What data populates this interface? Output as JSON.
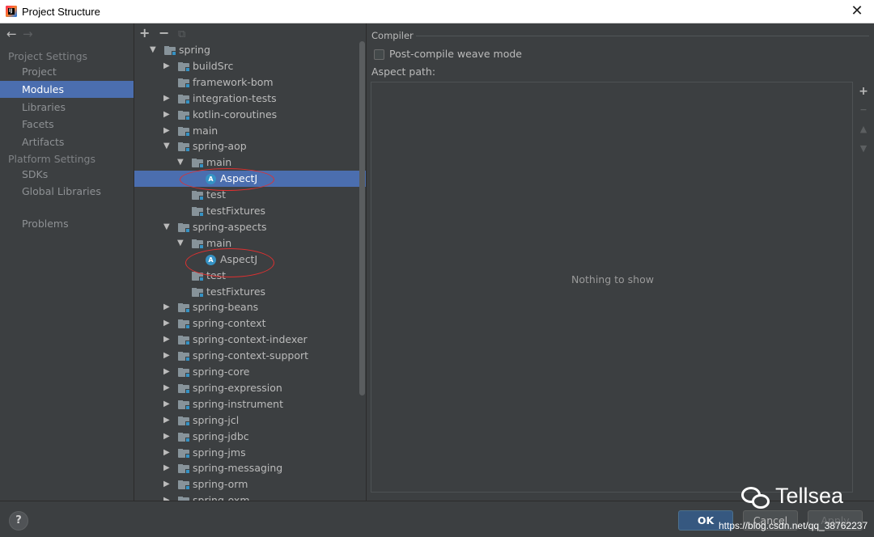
{
  "window": {
    "title": "Project Structure",
    "app_icon": "IJ",
    "close_glyph": "✕"
  },
  "sidebar": {
    "back_glyph": "←",
    "forward_glyph": "→",
    "project_settings_header": "Project Settings",
    "project_settings_items": [
      "Project",
      "Modules",
      "Libraries",
      "Facets",
      "Artifacts"
    ],
    "selected_item": "Modules",
    "platform_settings_header": "Platform Settings",
    "platform_settings_items": [
      "SDKs",
      "Global Libraries"
    ],
    "problems": "Problems"
  },
  "tree": {
    "toolbar": {
      "add": "+",
      "remove": "−",
      "copy": "⧉"
    },
    "rows": [
      {
        "label": "spring",
        "depth": 0,
        "expanded": true,
        "icon": "module-folder-icon"
      },
      {
        "label": "buildSrc",
        "depth": 1,
        "expanded": false,
        "icon": "module-folder-icon"
      },
      {
        "label": "framework-bom",
        "depth": 1,
        "expanded": null,
        "icon": "module-folder-icon"
      },
      {
        "label": "integration-tests",
        "depth": 1,
        "expanded": false,
        "icon": "module-folder-icon"
      },
      {
        "label": "kotlin-coroutines",
        "depth": 1,
        "expanded": false,
        "icon": "module-folder-icon"
      },
      {
        "label": "main",
        "depth": 1,
        "expanded": false,
        "icon": "module-folder-icon"
      },
      {
        "label": "spring-aop",
        "depth": 1,
        "expanded": true,
        "icon": "module-folder-icon"
      },
      {
        "label": "main",
        "depth": 2,
        "expanded": true,
        "icon": "module-folder-icon"
      },
      {
        "label": "AspectJ",
        "depth": 3,
        "expanded": null,
        "icon": "aspectj-facet-icon",
        "selected": true
      },
      {
        "label": "test",
        "depth": 2,
        "expanded": null,
        "icon": "module-folder-icon"
      },
      {
        "label": "testFixtures",
        "depth": 2,
        "expanded": null,
        "icon": "module-folder-icon"
      },
      {
        "label": "spring-aspects",
        "depth": 1,
        "expanded": true,
        "icon": "module-folder-icon"
      },
      {
        "label": "main",
        "depth": 2,
        "expanded": true,
        "icon": "module-folder-icon"
      },
      {
        "label": "AspectJ",
        "depth": 3,
        "expanded": null,
        "icon": "aspectj-facet-icon"
      },
      {
        "label": "test",
        "depth": 2,
        "expanded": null,
        "icon": "module-folder-icon"
      },
      {
        "label": "testFixtures",
        "depth": 2,
        "expanded": null,
        "icon": "module-folder-icon"
      },
      {
        "label": "spring-beans",
        "depth": 1,
        "expanded": false,
        "icon": "module-folder-icon"
      },
      {
        "label": "spring-context",
        "depth": 1,
        "expanded": false,
        "icon": "module-folder-icon"
      },
      {
        "label": "spring-context-indexer",
        "depth": 1,
        "expanded": false,
        "icon": "module-folder-icon"
      },
      {
        "label": "spring-context-support",
        "depth": 1,
        "expanded": false,
        "icon": "module-folder-icon"
      },
      {
        "label": "spring-core",
        "depth": 1,
        "expanded": false,
        "icon": "module-folder-icon"
      },
      {
        "label": "spring-expression",
        "depth": 1,
        "expanded": false,
        "icon": "module-folder-icon"
      },
      {
        "label": "spring-instrument",
        "depth": 1,
        "expanded": false,
        "icon": "module-folder-icon"
      },
      {
        "label": "spring-jcl",
        "depth": 1,
        "expanded": false,
        "icon": "module-folder-icon"
      },
      {
        "label": "spring-jdbc",
        "depth": 1,
        "expanded": false,
        "icon": "module-folder-icon"
      },
      {
        "label": "spring-jms",
        "depth": 1,
        "expanded": false,
        "icon": "module-folder-icon"
      },
      {
        "label": "spring-messaging",
        "depth": 1,
        "expanded": false,
        "icon": "module-folder-icon"
      },
      {
        "label": "spring-orm",
        "depth": 1,
        "expanded": false,
        "icon": "module-folder-icon"
      },
      {
        "label": "spring-oxm",
        "depth": 1,
        "expanded": false,
        "icon": "module-folder-icon"
      }
    ],
    "annotation_color": "#e03030"
  },
  "compiler": {
    "section_title": "Compiler",
    "post_compile_label": "Post-compile weave mode",
    "post_compile_checked": false,
    "aspect_path_label": "Aspect path:",
    "empty_text": "Nothing to show",
    "side_tools": {
      "add": "+",
      "remove": "−",
      "up": "▲",
      "down": "▼"
    }
  },
  "footer": {
    "help": "?",
    "ok": "OK",
    "cancel": "Cancel",
    "apply": "Apply"
  },
  "watermark": {
    "brand": "Tellsea",
    "url": "https://blog.csdn.net/qq_38762237"
  },
  "colors": {
    "background": "#3c3f41",
    "selection": "#4b6eaf",
    "ok_button": "#365880",
    "module_dot": "#3592c4"
  }
}
